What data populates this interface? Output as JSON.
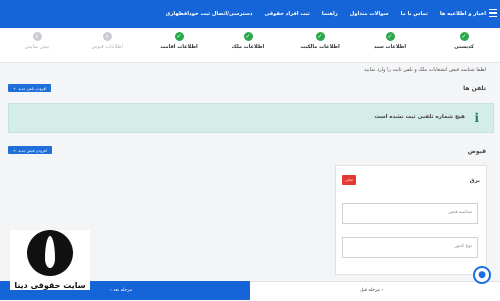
{
  "header": {
    "nav": [
      "اخبار و اطلاعیه ها",
      "تماس با ما",
      "سوالات متداول",
      "راهنما",
      "ثبت افراد حقوقی",
      "دسترسی/اتصال ثبت خودافظهاری"
    ]
  },
  "steps": [
    {
      "label": "کدپستی",
      "status": "done"
    },
    {
      "label": "اطلاعات سند",
      "status": "done"
    },
    {
      "label": "اطلاعات مالکیت",
      "status": "done"
    },
    {
      "label": "اطلاعات ملک",
      "status": "done"
    },
    {
      "label": "اطلاعات اقامت",
      "status": "done"
    },
    {
      "label": "اطلاعات قبوض",
      "status": "todo",
      "number": "۶"
    },
    {
      "label": "پیش نمایش",
      "status": "todo",
      "number": "۷"
    }
  ],
  "help_text": "لطفا شناسه قبض انشعابات ملک و تلفن ثابت را وارد نمایید",
  "phones": {
    "title": "تلفن ها",
    "add_button": "افزودن تلفن جدید",
    "empty_message": "هیچ شماره تلفنی ثبت نشده است"
  },
  "bills": {
    "title": "قبوض",
    "add_button": "افزودن قبض جدید",
    "card": {
      "title": "برق",
      "delete_label": "حذف",
      "fields": [
        {
          "placeholder": "شناسه قبض"
        },
        {
          "placeholder": "نوع کنتور"
        }
      ]
    }
  },
  "footer": {
    "next_label": "مرحله بعد",
    "prev_label": "مرحله قبل"
  },
  "logo_text": "سایت حقوقی دینا",
  "colors": {
    "primary": "#1565d8",
    "success": "#2aa84a",
    "danger": "#e53935",
    "info_bg": "#d4ede9"
  }
}
